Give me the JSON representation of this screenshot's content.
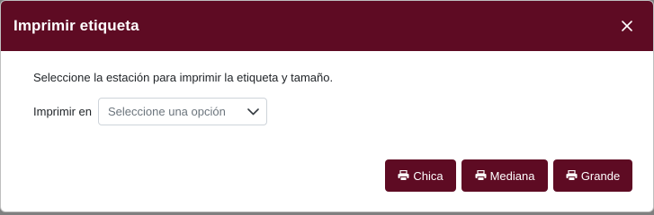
{
  "dialog": {
    "title": "Imprimir etiqueta",
    "instructions": "Seleccione la estación para imprimir la etiqueta y tamaño.",
    "printer_field": {
      "label": "Imprimir en",
      "placeholder": "Seleccione una opción"
    },
    "buttons": {
      "small": "Chica",
      "medium": "Mediana",
      "large": "Grande"
    },
    "icons": {
      "close": "close-icon",
      "dropdown": "chevron-down-icon",
      "print": "printer-icon"
    },
    "colors": {
      "primary": "#5e0b23",
      "text": "#212529",
      "placeholder": "#6c757d"
    }
  }
}
